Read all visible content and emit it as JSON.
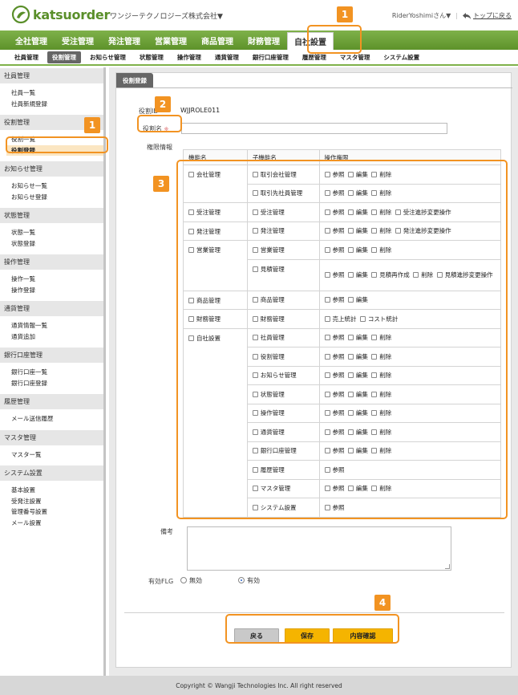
{
  "header": {
    "logo_text": "katsuorder",
    "company_name": "ワンジーテクノロジーズ株式会社▼",
    "user_name": "RiderYoshimiさん▼",
    "separator": "|",
    "back_to_top": "トップに戻る"
  },
  "main_nav": [
    {
      "label": "全社管理",
      "active": false
    },
    {
      "label": "受注管理",
      "active": false
    },
    {
      "label": "発注管理",
      "active": false
    },
    {
      "label": "営業管理",
      "active": false
    },
    {
      "label": "商品管理",
      "active": false
    },
    {
      "label": "財務管理",
      "active": false
    },
    {
      "label": "自社設置",
      "active": true
    }
  ],
  "sub_nav": [
    {
      "label": "社員管理",
      "active": false
    },
    {
      "label": "役割管理",
      "active": true
    },
    {
      "label": "お知らせ管理",
      "active": false
    },
    {
      "label": "状態管理",
      "active": false
    },
    {
      "label": "操作管理",
      "active": false
    },
    {
      "label": "通貨管理",
      "active": false
    },
    {
      "label": "銀行口座管理",
      "active": false
    },
    {
      "label": "履歴管理",
      "active": false
    },
    {
      "label": "マスタ管理",
      "active": false
    },
    {
      "label": "システム設置",
      "active": false
    }
  ],
  "sidebar": [
    {
      "section": "社員管理",
      "items": [
        {
          "label": "社員一覧"
        },
        {
          "label": "社員新規登録"
        }
      ]
    },
    {
      "section": "役割管理",
      "items": [
        {
          "label": "役割一覧"
        },
        {
          "label": "役割登録",
          "active": true
        }
      ]
    },
    {
      "section": "お知らせ管理",
      "items": [
        {
          "label": "お知らせ一覧"
        },
        {
          "label": "お知らせ登録"
        }
      ]
    },
    {
      "section": "状態管理",
      "items": [
        {
          "label": "状態一覧"
        },
        {
          "label": "状態登録"
        }
      ]
    },
    {
      "section": "操作管理",
      "items": [
        {
          "label": "操作一覧"
        },
        {
          "label": "操作登録"
        }
      ]
    },
    {
      "section": "通貨管理",
      "items": [
        {
          "label": "通貨情報一覧"
        },
        {
          "label": "通貨追加"
        }
      ]
    },
    {
      "section": "銀行口座管理",
      "items": [
        {
          "label": "銀行口座一覧"
        },
        {
          "label": "銀行口座登録"
        }
      ]
    },
    {
      "section": "履歴管理",
      "items": [
        {
          "label": "メール送信履歴"
        }
      ]
    },
    {
      "section": "マスタ管理",
      "items": [
        {
          "label": "マスター覧"
        }
      ]
    },
    {
      "section": "システム設置",
      "items": [
        {
          "label": "基本設置"
        },
        {
          "label": "受発注設置"
        },
        {
          "label": "管理番号設置"
        },
        {
          "label": "メール設置"
        }
      ]
    }
  ],
  "panel": {
    "tab_label": "役割登録",
    "role_id_label": "役割ID",
    "role_id_value": "WJJROLE011",
    "role_name_label": "役割名",
    "required_mark": "※",
    "role_name_value": "",
    "permission_label": "権限情報",
    "table_headers": [
      "機能名",
      "子機能名",
      "操作権限"
    ],
    "permission_groups": [
      {
        "function": "会社管理",
        "rows": [
          {
            "sub": "取引会社管理",
            "perms": [
              "参照",
              "編集",
              "削除"
            ]
          },
          {
            "sub": "取引先社員管理",
            "perms": [
              "参照",
              "編集",
              "削除"
            ]
          }
        ]
      },
      {
        "function": "受注管理",
        "rows": [
          {
            "sub": "受注管理",
            "perms": [
              "参照",
              "編集",
              "削除",
              "受注進捗変更操作"
            ]
          }
        ]
      },
      {
        "function": "発注管理",
        "rows": [
          {
            "sub": "発注管理",
            "perms": [
              "参照",
              "編集",
              "削除",
              "発注進捗変更操作"
            ]
          }
        ]
      },
      {
        "function": "営業管理",
        "rows": [
          {
            "sub": "営業管理",
            "perms": [
              "参照",
              "編集",
              "削除"
            ]
          },
          {
            "sub": "見積管理",
            "perms": [
              "参照",
              "編集",
              "見積再作成",
              "削除",
              "見積進捗変更操作"
            ],
            "tall": true
          }
        ]
      },
      {
        "function": "商品管理",
        "rows": [
          {
            "sub": "商品管理",
            "perms": [
              "参照",
              "編集"
            ]
          }
        ]
      },
      {
        "function": "財務管理",
        "rows": [
          {
            "sub": "財務管理",
            "perms": [
              "売上統計",
              "コスト統計"
            ]
          }
        ]
      },
      {
        "function": "自社設置",
        "rows": [
          {
            "sub": "社員管理",
            "perms": [
              "参照",
              "編集",
              "削除"
            ]
          },
          {
            "sub": "役割管理",
            "perms": [
              "参照",
              "編集",
              "削除"
            ]
          },
          {
            "sub": "お知らせ管理",
            "perms": [
              "参照",
              "編集",
              "削除"
            ]
          },
          {
            "sub": "状態管理",
            "perms": [
              "参照",
              "編集",
              "削除"
            ]
          },
          {
            "sub": "操作管理",
            "perms": [
              "参照",
              "編集",
              "削除"
            ]
          },
          {
            "sub": "通貨管理",
            "perms": [
              "参照",
              "編集",
              "削除"
            ]
          },
          {
            "sub": "銀行口座管理",
            "perms": [
              "参照",
              "編集",
              "削除"
            ]
          },
          {
            "sub": "履歴管理",
            "perms": [
              "参照"
            ]
          },
          {
            "sub": "マスタ管理",
            "perms": [
              "参照",
              "編集",
              "削除"
            ]
          },
          {
            "sub": "システム設置",
            "perms": [
              "参照"
            ]
          }
        ]
      }
    ],
    "remarks_label": "備考",
    "remarks_value": "",
    "valid_flag_label": "有効FLG",
    "flag_options": [
      {
        "label": "無効",
        "selected": false
      },
      {
        "label": "有効",
        "selected": true
      }
    ],
    "buttons": {
      "back": "戻る",
      "save": "保存",
      "confirm": "内容確認"
    }
  },
  "footer": {
    "copyright": "Copyright © Wangji Technologies Inc. All right reserved"
  },
  "callouts": {
    "c1": "1",
    "c2": "2",
    "c3": "3",
    "c4": "4"
  },
  "colors": {
    "brand_green": "#6aa336",
    "callout_orange": "#f29322",
    "save_orange": "#f5b400"
  }
}
